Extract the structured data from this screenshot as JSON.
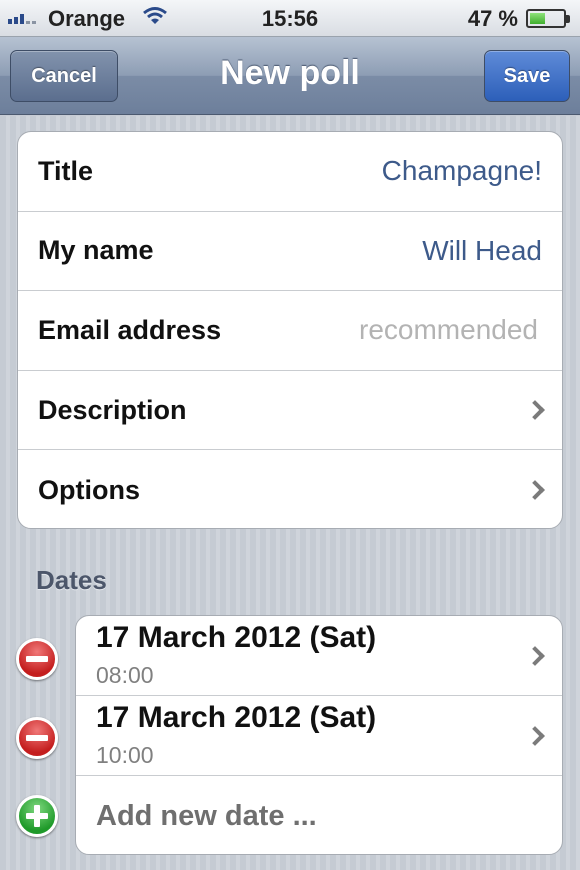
{
  "status_bar": {
    "carrier": "Orange",
    "time": "15:56",
    "battery": "47 %",
    "battery_level": 0.47
  },
  "nav": {
    "cancel_label": "Cancel",
    "title": "New poll",
    "save_label": "Save"
  },
  "form": {
    "title_label": "Title",
    "title_value": "Champagne!",
    "name_label": "My name",
    "name_value": "Will Head",
    "email_label": "Email address",
    "email_placeholder": "recommended",
    "description_label": "Description",
    "options_label": "Options"
  },
  "dates": {
    "header": "Dates",
    "items": [
      {
        "date": "17 March 2012 (Sat)",
        "time": "08:00"
      },
      {
        "date": "17 March 2012 (Sat)",
        "time": "10:00"
      }
    ],
    "add_label": "Add new date ..."
  },
  "colors": {
    "accent_blue": "#3d5a8a",
    "save_button": "#2d5fb9",
    "delete_red": "#c41e1e",
    "add_green": "#1f9a2a"
  }
}
